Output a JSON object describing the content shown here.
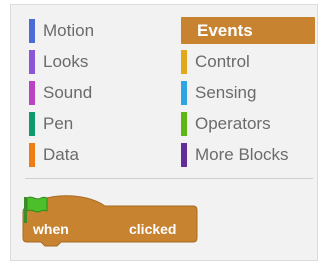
{
  "categories": {
    "left": [
      {
        "label": "Motion",
        "color": "#4a6cd4"
      },
      {
        "label": "Looks",
        "color": "#8a55d7"
      },
      {
        "label": "Sound",
        "color": "#bb42c3"
      },
      {
        "label": "Pen",
        "color": "#0e9a6c"
      },
      {
        "label": "Data",
        "color": "#ee7d16"
      }
    ],
    "right": [
      {
        "label": "Events",
        "color": "#c88330",
        "selected": true
      },
      {
        "label": "Control",
        "color": "#e1a91a"
      },
      {
        "label": "Sensing",
        "color": "#2ca5e2"
      },
      {
        "label": "Operators",
        "color": "#5cb712"
      },
      {
        "label": "More Blocks",
        "color": "#632d99"
      }
    ]
  },
  "block": {
    "when_label": "when",
    "clicked_label": "clicked",
    "icon": "green-flag-icon",
    "color": "#c88330",
    "flag_color": "#4cbf2a"
  }
}
